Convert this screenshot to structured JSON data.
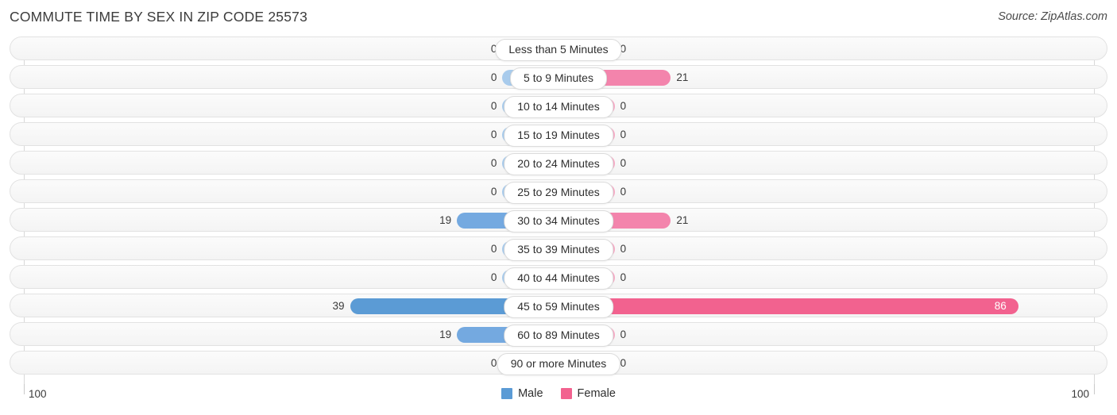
{
  "header": {
    "title": "COMMUTE TIME BY SEX IN ZIP CODE 25573",
    "source": "Source: ZipAtlas.com"
  },
  "legend": {
    "male_label": "Male",
    "female_label": "Female",
    "male_color": "#5B9BD5",
    "female_color": "#F2628F"
  },
  "axis": {
    "left_label": "100",
    "right_label": "100"
  },
  "chart_data": {
    "type": "bar",
    "title": "COMMUTE TIME BY SEX IN ZIP CODE 25573",
    "subtitle": "Source: ZipAtlas.com",
    "orientation": "horizontal-diverging",
    "xlabel": "",
    "ylabel": "",
    "xlim": [
      100,
      100
    ],
    "axis_left_max": 100,
    "axis_right_max": 100,
    "grid": true,
    "legend_position": "bottom-center",
    "categories": [
      "Less than 5 Minutes",
      "5 to 9 Minutes",
      "10 to 14 Minutes",
      "15 to 19 Minutes",
      "20 to 24 Minutes",
      "25 to 29 Minutes",
      "30 to 34 Minutes",
      "35 to 39 Minutes",
      "40 to 44 Minutes",
      "45 to 59 Minutes",
      "60 to 89 Minutes",
      "90 or more Minutes"
    ],
    "series": [
      {
        "name": "Male",
        "color": "#5B9BD5",
        "values": [
          0,
          0,
          0,
          0,
          0,
          0,
          19,
          0,
          0,
          39,
          19,
          0
        ]
      },
      {
        "name": "Female",
        "color": "#F2628F",
        "values": [
          0,
          21,
          0,
          0,
          0,
          0,
          21,
          0,
          0,
          86,
          0,
          0
        ]
      }
    ]
  },
  "rows": [
    {
      "label": "Less than 5 Minutes",
      "male": "0",
      "female": "0"
    },
    {
      "label": "5 to 9 Minutes",
      "male": "0",
      "female": "21"
    },
    {
      "label": "10 to 14 Minutes",
      "male": "0",
      "female": "0"
    },
    {
      "label": "15 to 19 Minutes",
      "male": "0",
      "female": "0"
    },
    {
      "label": "20 to 24 Minutes",
      "male": "0",
      "female": "0"
    },
    {
      "label": "25 to 29 Minutes",
      "male": "0",
      "female": "0"
    },
    {
      "label": "30 to 34 Minutes",
      "male": "19",
      "female": "21"
    },
    {
      "label": "35 to 39 Minutes",
      "male": "0",
      "female": "0"
    },
    {
      "label": "40 to 44 Minutes",
      "male": "0",
      "female": "0"
    },
    {
      "label": "45 to 59 Minutes",
      "male": "39",
      "female": "86"
    },
    {
      "label": "60 to 89 Minutes",
      "male": "19",
      "female": "0"
    },
    {
      "label": "90 or more Minutes",
      "male": "0",
      "female": "0"
    }
  ]
}
